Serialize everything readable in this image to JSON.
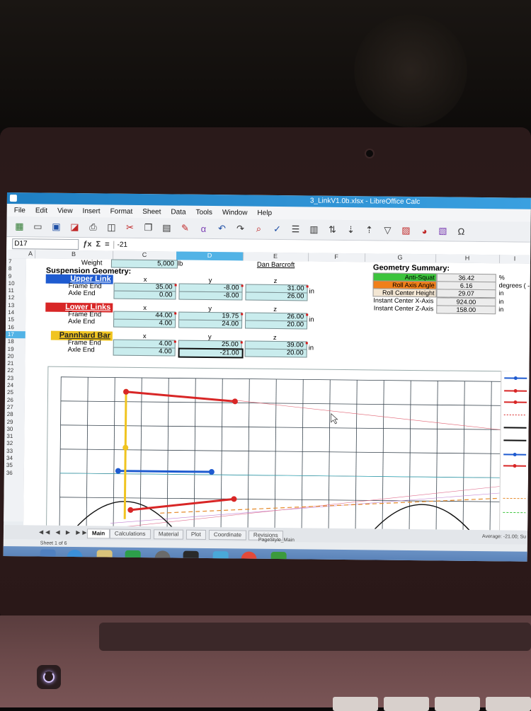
{
  "window": {
    "title": "3_LinkV1.0b.xlsx - LibreOffice Calc"
  },
  "menu": [
    "File",
    "Edit",
    "View",
    "Insert",
    "Format",
    "Sheet",
    "Data",
    "Tools",
    "Window",
    "Help"
  ],
  "formula_bar": {
    "cell_ref": "D17",
    "sigma": "Σ",
    "equals": "=",
    "value": "-21"
  },
  "columns": [
    "A",
    "B",
    "C",
    "D",
    "E",
    "F",
    "G",
    "H",
    "I"
  ],
  "rows": [
    "7",
    "8",
    "9",
    "10",
    "11",
    "12",
    "13",
    "14",
    "15",
    "16",
    "17",
    "18",
    "19",
    "20",
    "21",
    "22",
    "23",
    "24",
    "25",
    "26",
    "27",
    "28",
    "29",
    "30",
    "31",
    "32",
    "33",
    "34",
    "35",
    "36"
  ],
  "sheet": {
    "weight_label": "Weight",
    "weight_value": "5,000",
    "weight_unit": "lb",
    "author": "Dan Barcroft",
    "section_title": "Suspension Geometry:",
    "axis_x": "x",
    "axis_y": "y",
    "axis_z": "z",
    "upper_link": {
      "title": "Upper Link",
      "frame_label": "Frame End",
      "axle_label": "Axle End",
      "frame": [
        "35.00",
        "-8.00",
        "31.00"
      ],
      "axle": [
        "0.00",
        "-8.00",
        "26.00"
      ],
      "unit": "in"
    },
    "lower_links": {
      "title": "Lower Links",
      "frame_label": "Frame End",
      "axle_label": "Axle End",
      "frame": [
        "44.00",
        "19.75",
        "26.00"
      ],
      "axle": [
        "4.00",
        "24.00",
        "20.00"
      ],
      "unit": "in"
    },
    "pannhard": {
      "title": "Pannhard Bar",
      "frame_label": "Frame End",
      "axle_label": "Axle End",
      "frame": [
        "4.00",
        "25.00",
        "39.00"
      ],
      "axle": [
        "4.00",
        "-21.00",
        "20.00"
      ],
      "unit": "in"
    }
  },
  "summary": {
    "title": "Geometry Summary:",
    "rows": [
      {
        "label": "Anti-Squat",
        "value": "36.42",
        "unit": "%",
        "color": "#3cc43c"
      },
      {
        "label": "Roll Axis Angle",
        "value": "6.16",
        "unit": "degrees ( - ro",
        "color": "#f07f1a"
      },
      {
        "label": "Roll Center Height",
        "value": "29.07",
        "unit": "in",
        "color": "#f3e6d3"
      },
      {
        "label": "Instant Center X-Axis",
        "value": "924.00",
        "unit": "in",
        "color": "#ffffff"
      },
      {
        "label": "Instant Center Z-Axis",
        "value": "158.00",
        "unit": "in",
        "color": "#ffffff"
      }
    ]
  },
  "tabs": [
    "Main",
    "Calculations",
    "Material",
    "Plot",
    "Coordinate",
    "Revisions"
  ],
  "status": {
    "sheet": "Sheet 1 of 6",
    "page_style": "PageStyle_Main",
    "average": "Average: -21.00; Su"
  },
  "colors": {
    "upper": "#1f5bd0",
    "lower": "#d82626",
    "pannhard": "#f0c420",
    "cell_fill": "#c9eced"
  }
}
